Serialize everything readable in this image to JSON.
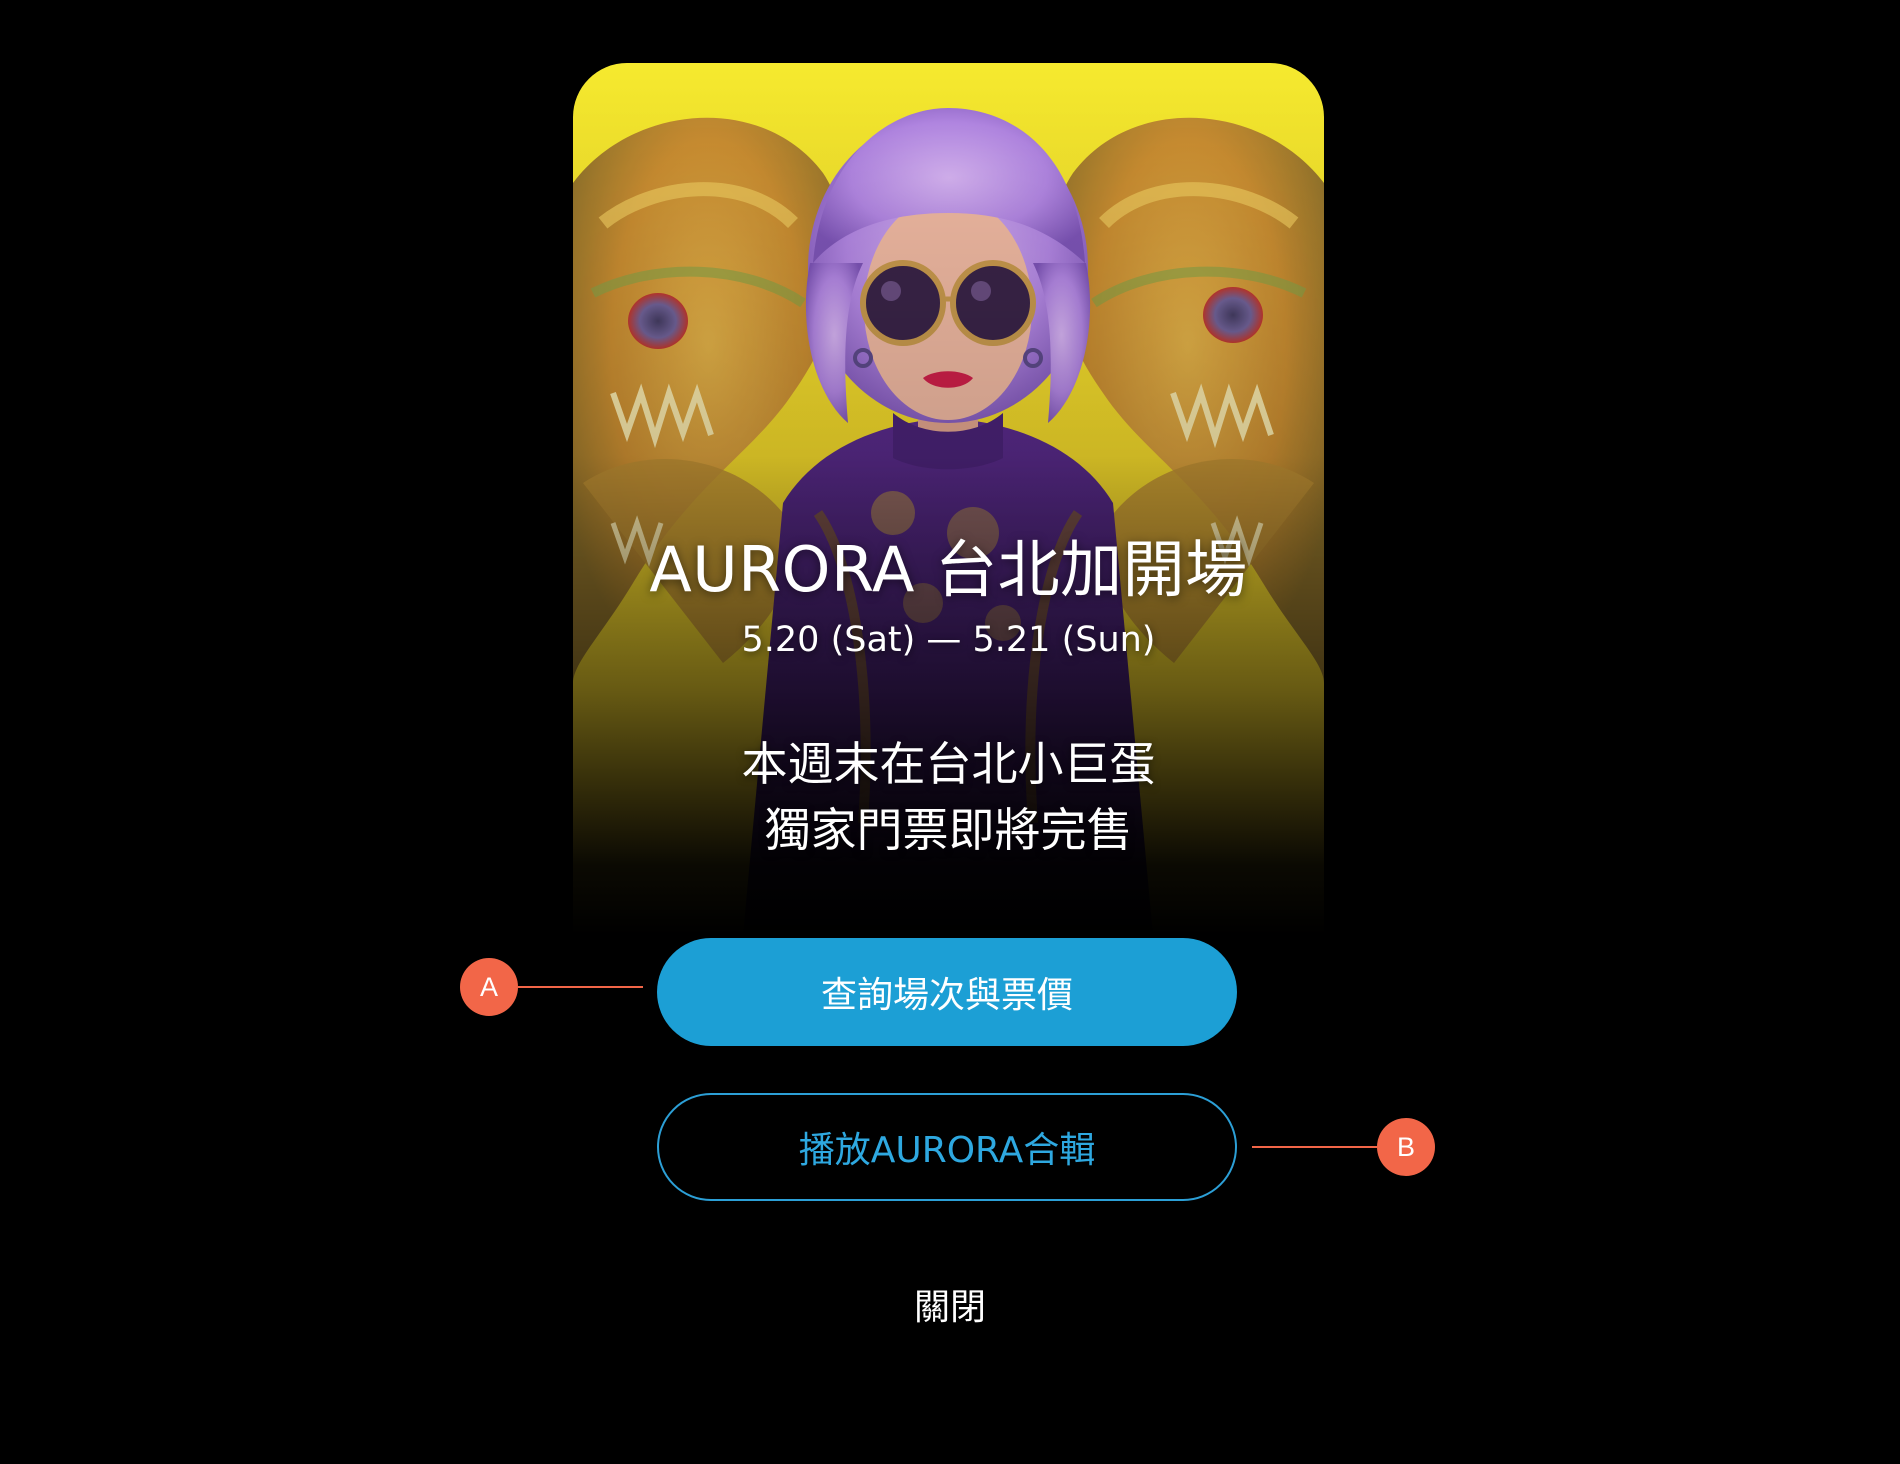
{
  "poster": {
    "title": "AURORA 台北加開場",
    "dates": "5.20 (Sat) —  5.21 (Sun)",
    "tagline_line1": "本週末在台北小巨蛋",
    "tagline_line2": "獨家門票即將完售"
  },
  "actions": {
    "primary_label": "查詢場次與票價",
    "secondary_label": "播放AURORA合輯",
    "close_label": "關閉"
  },
  "annotations": {
    "marker_a": "A",
    "marker_b": "B"
  },
  "colors": {
    "background": "#000000",
    "primary_button": "#1c9fd5",
    "secondary_button_border": "#2c9fd6",
    "secondary_button_text": "#2ea8e0",
    "annotation": "#f26648",
    "poster_yellow": "#f2e227",
    "hair_purple": "#b98ae6"
  }
}
